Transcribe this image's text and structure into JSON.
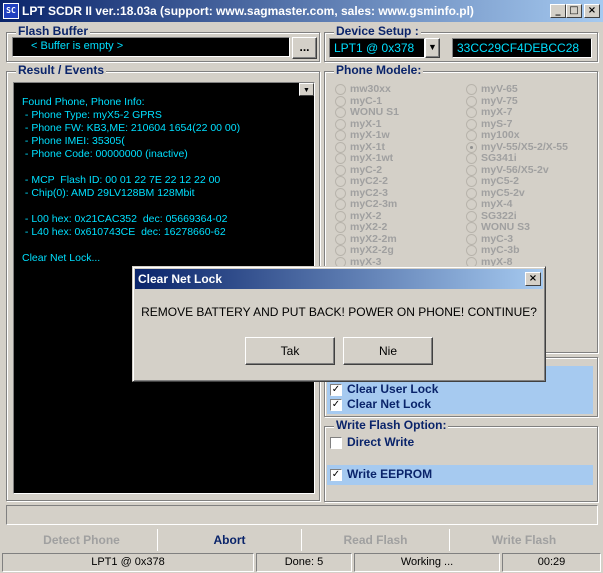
{
  "window": {
    "title": "LPT SCDR II ver.:18.03a (support: www.sagmaster.com, sales: www.gsminfo.pl)",
    "minimize": "_",
    "maximize": "□",
    "close": "×"
  },
  "flash_buffer": {
    "label": "Flash Buffer",
    "value": "< Buffer is empty >",
    "browse_button": "..."
  },
  "device_setup": {
    "label": "Device Setup :",
    "port": "LPT1 @ 0x378",
    "code": "33CC29CF4DEBCC28"
  },
  "result": {
    "label": "Result / Events",
    "lines": [
      "Found Phone, Phone Info:",
      " - Phone Type: myX5-2 GPRS",
      " - Phone FW: KB3,ME: 210604 1654(22 00 00)",
      " - Phone IMEI: 35305(",
      " - Phone Code: 00000000 (inactive)",
      "",
      " - MCP  Flash ID: 00 01 22 7E 22 12 22 00",
      " - Chip(0): AMD 29LV128BM 128Mbit",
      "",
      " - L00 hex: 0x21CAC352  dec: 05669364-02",
      " - L40 hex: 0x610743CE  dec: 16278660-62",
      "",
      "Clear Net Lock..."
    ]
  },
  "phone_models": {
    "label": "Phone Modele:",
    "col1": [
      "mw30xx",
      "myC-1",
      "WONU S1",
      "myX-1",
      "myX-1w",
      "myX-1t",
      "myX-1wt",
      "myC-2",
      "myC2-2",
      "myC2-3",
      "myC2-3m",
      "myX-2",
      "myX2-2",
      "myX2-2m",
      "myX2-2g",
      "myX-3",
      "myX3-2"
    ],
    "col2": [
      "myV-65",
      "myV-75",
      "myX-7",
      "myS-7",
      "my100x",
      "myV-55/X5-2/X-55",
      "SG341i",
      "myV-56/X5-2v",
      "myC5-2",
      "myC5-2v",
      "myX-4",
      "SG322i",
      "WONU S3",
      "myC-3",
      "myC-3b",
      "myX-8",
      "SG343i"
    ],
    "selected_col2_index": 5
  },
  "unlock_options": {
    "clear_user_lock": "Clear User Lock",
    "clear_net_lock": "Clear Net Lock"
  },
  "write_flash": {
    "label": "Write Flash Option:",
    "direct_write": "Direct Write",
    "write_eeprom": "Write EEPROM"
  },
  "toolbar": {
    "detect": "Detect Phone",
    "abort": "Abort",
    "read": "Read Flash",
    "write": "Write Flash"
  },
  "statusbar": {
    "port": "LPT1 @ 0x378",
    "done": "Done: 5",
    "state": "Working ...",
    "time": "00:29"
  },
  "dialog": {
    "title": "Clear Net Lock",
    "close": "×",
    "message": "REMOVE BATTERY AND PUT BACK! POWER ON PHONE! CONTINUE?",
    "yes": "Tak",
    "no": "Nie"
  }
}
